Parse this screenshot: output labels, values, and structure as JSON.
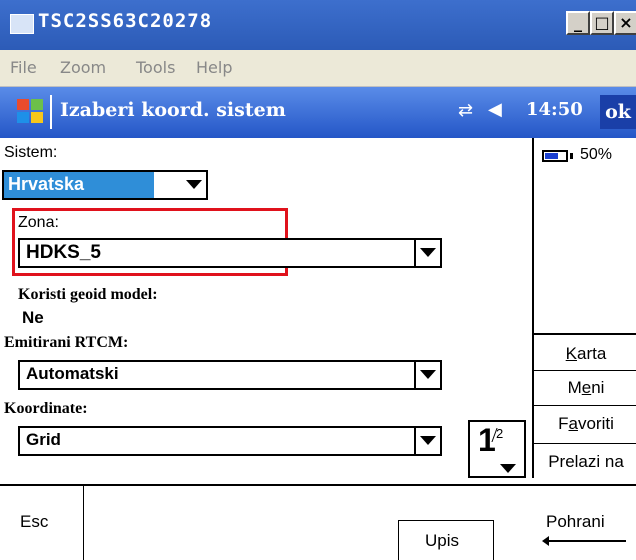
{
  "window": {
    "title": "TSC2SS63C20278",
    "minimize": "_",
    "maximize": "□",
    "close": "×"
  },
  "menubar": {
    "items": [
      "File",
      "Zoom",
      "Tools",
      "Help"
    ]
  },
  "header": {
    "title": "Izaberi koord. sistem",
    "time": "14:50",
    "ok": "ok"
  },
  "battery": {
    "level": "50%"
  },
  "form": {
    "sistem_label": "Sistem:",
    "sistem_value": "Hrvatska",
    "zona_label": "Zona:",
    "zona_value": "HDKS_5",
    "geoid_label": "Koristi geoid model:",
    "geoid_value": "Ne",
    "rtcm_label": "Emitirani RTCM:",
    "rtcm_value": "Automatski",
    "koord_label": "Koordinate:",
    "koord_value": "Grid"
  },
  "pager": {
    "current": "1",
    "total": "2"
  },
  "side": {
    "karta": "Karta",
    "meni": "Meni",
    "favoriti": "Favoriti",
    "prelazi": "Prelazi na"
  },
  "bottom": {
    "esc": "Esc",
    "upis": "Upis",
    "pohrani": "Pohrani"
  }
}
